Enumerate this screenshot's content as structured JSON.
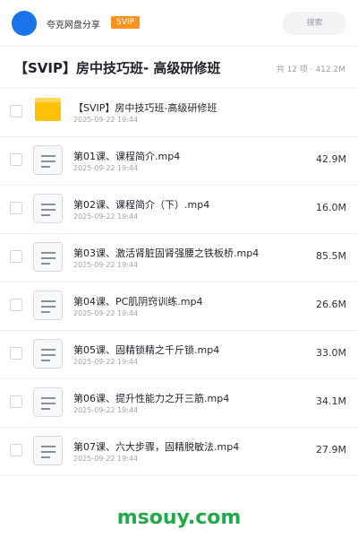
{
  "header": {
    "brand": "夸克网盘分享",
    "vip_badge": "SVIP",
    "search_label": "搜索",
    "colors": {
      "avatar": "#1a73e8",
      "badge": "#f7931e"
    }
  },
  "folder": {
    "title": "【SVIP】房中技巧班- 高级研修班",
    "meta": "共 12 项 · 412.2M"
  },
  "files": [
    {
      "type": "folder",
      "icon": "folder-icon",
      "name": "【SVIP】房中技巧班-高级研修班",
      "date": "2025-09-22 19:44",
      "size": ""
    },
    {
      "type": "file",
      "icon": "document-icon",
      "name": "第01课、课程简介.mp4",
      "date": "2025-09-22 19:44",
      "size": "42.9M"
    },
    {
      "type": "file",
      "icon": "document-icon",
      "name": "第02课、课程简介（下）.mp4",
      "date": "2025-09-22 19:44",
      "size": "16.0M"
    },
    {
      "type": "file",
      "icon": "document-icon",
      "name": "第03课、激活肾脏固肾强腰之铁板桥.mp4",
      "date": "2025-09-22 19:44",
      "size": "85.5M"
    },
    {
      "type": "file",
      "icon": "document-icon",
      "name": "第04课、PC肌阴窍训练.mp4",
      "date": "2025-09-22 19:44",
      "size": "26.6M"
    },
    {
      "type": "file",
      "icon": "document-icon",
      "name": "第05课、固精锁精之千斤锁.mp4",
      "date": "2025-09-22 19:44",
      "size": "33.0M"
    },
    {
      "type": "file",
      "icon": "document-icon",
      "name": "第06课、提升性能力之开三筋.mp4",
      "date": "2025-09-22 19:44",
      "size": "34.1M"
    },
    {
      "type": "file",
      "icon": "document-icon",
      "name": "第07课、六大步骤，固精脱敏法.mp4",
      "date": "2025-09-22 19:44",
      "size": "27.9M"
    }
  ],
  "watermark": "msouy.com"
}
